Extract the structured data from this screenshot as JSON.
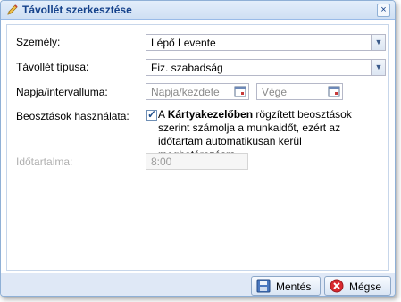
{
  "window": {
    "title": "Távollét szerkesztése",
    "close_glyph": "×",
    "title_icon": "pencil-icon"
  },
  "form": {
    "person": {
      "label": "Személy:",
      "value": "Lépő Levente"
    },
    "absence_type": {
      "label": "Távollét típusa:",
      "value": "Fiz. szabadság"
    },
    "date_range": {
      "label": "Napja/intervalluma:",
      "start_placeholder": "Napja/kezdete",
      "end_placeholder": "Vége"
    },
    "schedules": {
      "label": "Beosztások használata:",
      "checked": true,
      "check_glyph": "✓",
      "desc_prefix": "A ",
      "desc_bold": "Kártyakezelőben",
      "desc_suffix": " rögzített beosztások szerint számolja a munkaidőt, ezért az időtartam automatikusan kerül meghatározásra."
    },
    "duration": {
      "label": "Időtartalma:",
      "value": "8:00"
    }
  },
  "footer": {
    "save_label": "Mentés",
    "cancel_label": "Mégse"
  },
  "colors": {
    "title_text": "#15428b",
    "accent_border": "#99bbe8",
    "footer_bg": "#dfe8f6",
    "cancel_icon": "#d9282f"
  }
}
